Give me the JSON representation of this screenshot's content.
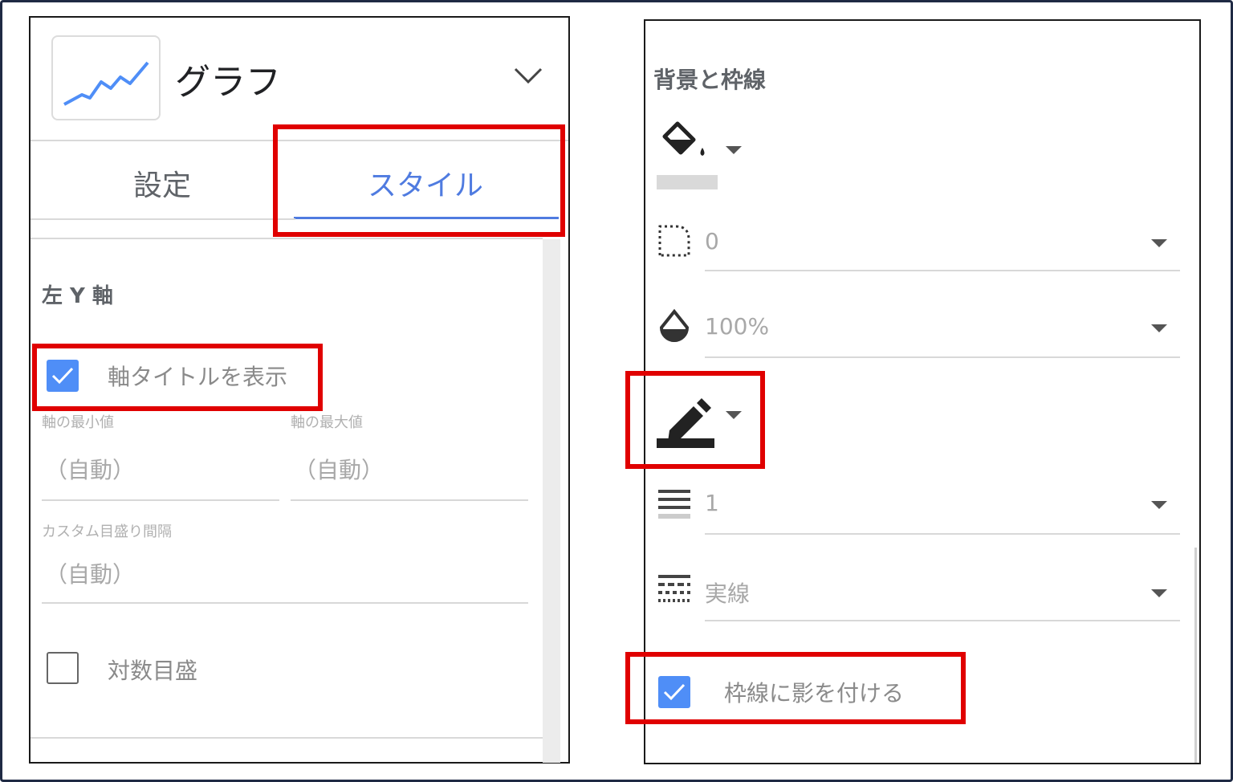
{
  "left_panel": {
    "chart_title": "グラフ",
    "tabs": [
      {
        "label": "設定",
        "active": false
      },
      {
        "label": "スタイル",
        "active": true
      }
    ],
    "section_title": "左 Y 軸",
    "show_axis_title": {
      "label": "軸タイトルを表示",
      "checked": true
    },
    "axis_min": {
      "label": "軸の最小値",
      "value": "（自動）"
    },
    "axis_max": {
      "label": "軸の最大値",
      "value": "（自動）"
    },
    "custom_tick": {
      "label": "カスタム目盛り間隔",
      "value": "（自動）"
    },
    "log_scale": {
      "label": "対数目盛",
      "checked": false
    }
  },
  "right_panel": {
    "section_title": "背景と枠線",
    "corner_radius": "0",
    "opacity": "100%",
    "border_weight": "1",
    "border_style": "実線",
    "border_shadow": {
      "label": "枠線に影を付ける",
      "checked": true
    }
  },
  "colors": {
    "accent_blue": "#4f7be0",
    "checkbox_blue": "#4f8ef7",
    "highlight_red": "#e00000"
  }
}
